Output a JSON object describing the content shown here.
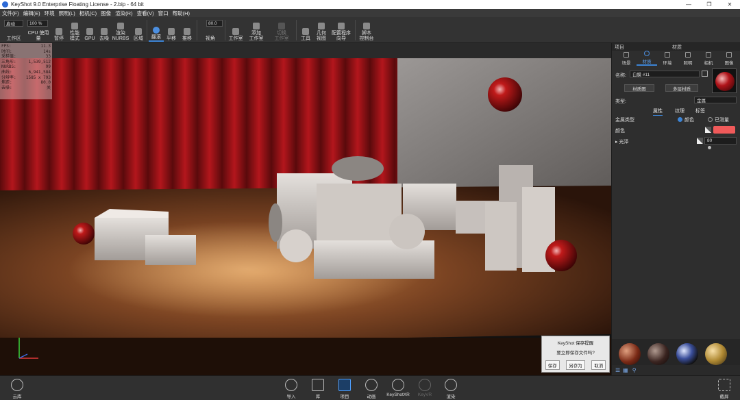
{
  "window": {
    "title": "KeyShot 9.0 Enterprise Floating License  - 2.bip  - 64 bit",
    "controls": [
      "—",
      "❐",
      "✕"
    ]
  },
  "menu": [
    "文件(F)",
    "编辑(E)",
    "环境",
    "照明(L)",
    "相机(C)",
    "图像",
    "渲染(R)",
    "查看(V)",
    "窗口",
    "帮助(H)"
  ],
  "toolbar": {
    "workspace_select": "启动",
    "cpu_percent": "100 %",
    "fov_value": "80.0",
    "items": [
      {
        "label": "工作区",
        "name": "workspace"
      },
      {
        "label": "CPU 使用量",
        "name": "cpu-usage"
      },
      {
        "label": "暂停",
        "name": "pause"
      },
      {
        "label": "性能\n模式",
        "name": "performance-mode"
      },
      {
        "label": "GPU",
        "name": "gpu"
      },
      {
        "label": "去噪",
        "name": "denoise"
      },
      {
        "label": "渲染\nNURBS",
        "name": "render-nurbs"
      },
      {
        "label": "区域",
        "name": "region"
      },
      {
        "label": "翻滚",
        "name": "tumble"
      },
      {
        "label": "平移",
        "name": "pan"
      },
      {
        "label": "推移",
        "name": "dolly"
      },
      {
        "label": "视角",
        "name": "perspective"
      },
      {
        "label": "工作室",
        "name": "studio"
      },
      {
        "label": "添加\n工作室",
        "name": "add-studio"
      },
      {
        "label": "切换\n工作室",
        "name": "switch-studio"
      },
      {
        "label": "工具",
        "name": "tools"
      },
      {
        "label": "几何\n视图",
        "name": "geometry-view"
      },
      {
        "label": "配置程序\n向导",
        "name": "configurator-wizard"
      },
      {
        "label": "脚本\n控制台",
        "name": "script-console"
      }
    ]
  },
  "stats": [
    {
      "k": "FPS:",
      "v": "11.3"
    },
    {
      "k": "时间:",
      "v": "14s"
    },
    {
      "k": "采样值:",
      "v": "33"
    },
    {
      "k": "三角形:",
      "v": "1,539,512"
    },
    {
      "k": "NURBS:",
      "v": "99"
    },
    {
      "k": "曲线:",
      "v": "6,941,584"
    },
    {
      "k": "分辨率:",
      "v": "1585 x 793"
    },
    {
      "k": "焦距:",
      "v": "80.0"
    },
    {
      "k": "去噪:",
      "v": "关"
    }
  ],
  "save_dialog": {
    "title": "KeyShot 保存提醒",
    "message": "要立即保存文件吗?",
    "save": "保存",
    "save_as": "另存为",
    "cancel": "取消"
  },
  "panel": {
    "left_title": "项目",
    "center_title": "材质",
    "tabs": [
      "场景",
      "材质",
      "环境",
      "照明",
      "相机",
      "图像"
    ],
    "name_label": "名称:",
    "name_value": "白膜 #11",
    "material_graph": "材质图",
    "multi_layer": "多层材质",
    "type_label": "类型:",
    "type_value": "金属",
    "subtabs": [
      "属性",
      "纹理",
      "标签"
    ],
    "metal_type_label": "金属类型",
    "radio_color": "颜色",
    "radio_measured": "已测量",
    "color_label": "颜色",
    "color_hex": "#f05a5a",
    "gloss_label": "光泽",
    "gloss_value": "80"
  },
  "bottom": [
    {
      "label": "云库",
      "name": "cloud-library"
    },
    {
      "label": "导入",
      "name": "import"
    },
    {
      "label": "库",
      "name": "library"
    },
    {
      "label": "项目",
      "name": "project"
    },
    {
      "label": "动画",
      "name": "animation"
    },
    {
      "label": "KeyShotXR",
      "name": "keyshotxr"
    },
    {
      "label": "KeyVR",
      "name": "keyvr"
    },
    {
      "label": "渲染",
      "name": "render"
    },
    {
      "label": "截屏",
      "name": "screenshot"
    }
  ]
}
